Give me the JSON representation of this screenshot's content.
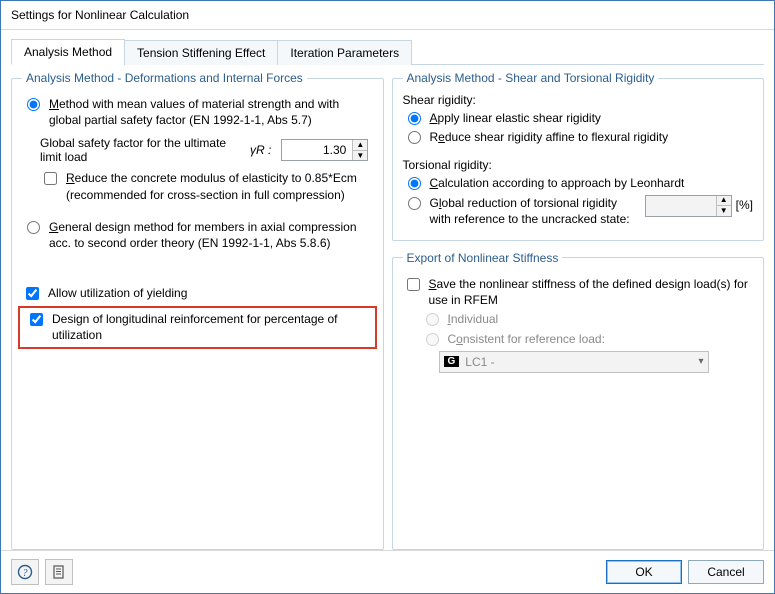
{
  "window": {
    "title": "Settings for Nonlinear Calculation"
  },
  "tabs": [
    {
      "label": "Analysis Method",
      "active": true
    },
    {
      "label": "Tension Stiffening Effect",
      "active": false
    },
    {
      "label": "Iteration Parameters",
      "active": false
    }
  ],
  "left": {
    "group_title": "Analysis Method - Deformations and Internal Forces",
    "method_mean": {
      "label": "Method with mean values of material strength and with global partial safety factor (EN 1992-1-1, Abs 5.7)",
      "checked": true
    },
    "safety_label": "Global safety factor for the ultimate limit load",
    "gamma_symbol": "γR :",
    "gamma_value": "1.30",
    "reduce_modulus": {
      "label": "Reduce the concrete modulus of elasticity to 0.85*Ecm (recommended for cross-section in full compression)",
      "checked": false
    },
    "method_general": {
      "label": "General design method for members in axial compression acc. to second order theory (EN 1992-1-1, Abs 5.8.6)",
      "checked": false
    },
    "allow_yielding": {
      "label": "Allow utilization of yielding",
      "checked": true
    },
    "design_long_reinf": {
      "label": "Design of longitudinal reinforcement for percentage of utilization",
      "checked": true
    }
  },
  "right": {
    "group_shear_title": "Analysis Method - Shear and Torsional Rigidity",
    "shear_heading": "Shear rigidity:",
    "shear_linear": {
      "label": "Apply linear elastic shear rigidity",
      "checked": true
    },
    "shear_reduce": {
      "label": "Reduce shear rigidity affine to flexural rigidity",
      "checked": false
    },
    "torsion_heading": "Torsional rigidity:",
    "torsion_leonhardt": {
      "label": "Calculation according to approach by Leonhardt",
      "checked": true
    },
    "torsion_global": {
      "label": "Global reduction of torsional rigidity with reference to the uncracked state:",
      "checked": false
    },
    "torsion_pct_unit": "[%]",
    "group_export_title": "Export of Nonlinear Stiffness",
    "save_stiffness": {
      "label": "Save the nonlinear stiffness of the defined design load(s) for use in RFEM",
      "checked": false
    },
    "export_individual": {
      "label": "Individual"
    },
    "export_consistent": {
      "label": "Consistent for reference load:"
    },
    "ref_load": {
      "badge": "G",
      "label": "LC1 -"
    }
  },
  "footer": {
    "ok": "OK",
    "cancel": "Cancel"
  }
}
